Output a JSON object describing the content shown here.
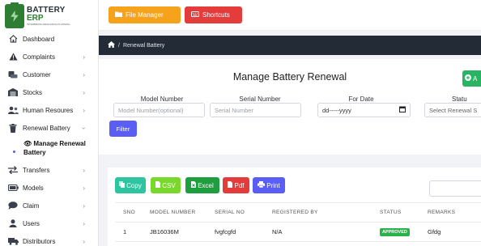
{
  "logo": {
    "line1": "BATTERY",
    "line2": "ERP",
    "line3": "INTERBRAND RESOURCE PLANNING"
  },
  "sidebar": {
    "items": [
      {
        "label": "Dashboard",
        "icon": "dashboard-icon"
      },
      {
        "label": "Complaints",
        "icon": "warning-icon"
      },
      {
        "label": "Customer",
        "icon": "customer-icon"
      },
      {
        "label": "Stocks",
        "icon": "warehouse-icon"
      },
      {
        "label": "Human Resoures",
        "icon": "people-icon"
      },
      {
        "label": "Renewal Battery",
        "icon": "trash-icon"
      },
      {
        "label": "Transfers",
        "icon": "transfer-icon"
      },
      {
        "label": "Models",
        "icon": "battery-icon"
      },
      {
        "label": "Claim",
        "icon": "chat-icon"
      },
      {
        "label": "Users",
        "icon": "user-icon"
      },
      {
        "label": "Distributors",
        "icon": "truck-icon"
      }
    ],
    "submenu_label": "Manage Renewal Battery"
  },
  "topbar": {
    "file_manager": "File Manager",
    "shortcuts": "Shortcuts"
  },
  "breadcrumb": {
    "current": "Renewal Battery"
  },
  "panel": {
    "title": "Manage Battery Renewal",
    "add_label": "A",
    "filters": {
      "model_label": "Model Number",
      "model_placeholder": "Model Number(optional)",
      "serial_label": "Serial Number",
      "serial_placeholder": "Serial Number",
      "date_label": "For Date",
      "date_placeholder": "dd-----yyyy",
      "status_label": "Statu",
      "status_value": "Select Renewal S"
    },
    "filter_button": "Filter"
  },
  "export": {
    "copy": "Copy",
    "csv": "CSV",
    "excel": "Excel",
    "pdf": "Pdf",
    "print": "Print"
  },
  "table": {
    "headers": [
      "SNO",
      "MODEL NUMBER",
      "SERIAL NO",
      "REGISTERED BY",
      "STATUS",
      "REMARKS"
    ],
    "rows": [
      {
        "sno": "1",
        "model": "JB16036M",
        "serial": "fvgfcgfd",
        "registered_by": "N/A",
        "status": "APPROVED",
        "remarks": "Gfdg"
      }
    ]
  },
  "colors": {
    "accent": "#5b5ef4",
    "file_manager": "#f7a21b",
    "danger": "#e43b3b",
    "success": "#2bb24c",
    "breadcrumb_bg": "#222b36"
  }
}
